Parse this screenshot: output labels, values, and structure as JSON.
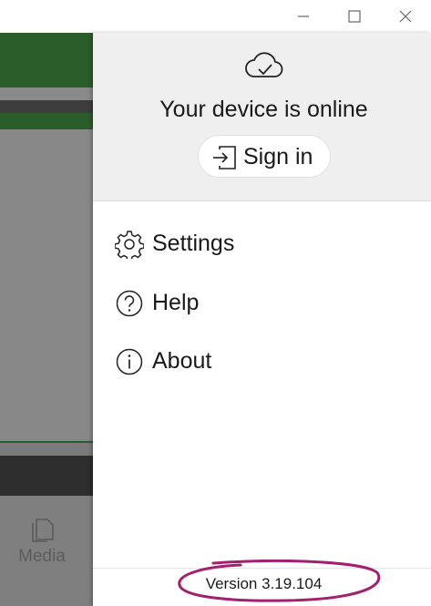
{
  "window": {
    "controls": [
      "minimize-icon",
      "maximize-icon",
      "close-icon"
    ]
  },
  "background_app": {
    "media_label": "Media",
    "media_icon": "copy-pages-icon"
  },
  "panel": {
    "status_icon": "cloud-check-icon",
    "status_text": "Your device is online",
    "sign_in_label": "Sign in",
    "sign_in_icon": "sign-in-icon",
    "menu": [
      {
        "label": "Settings",
        "icon": "gear-icon"
      },
      {
        "label": "Help",
        "icon": "help-circle-icon"
      },
      {
        "label": "About",
        "icon": "info-circle-icon"
      }
    ],
    "version": "Version 3.19.104",
    "annotation_color": "#a3206f"
  }
}
